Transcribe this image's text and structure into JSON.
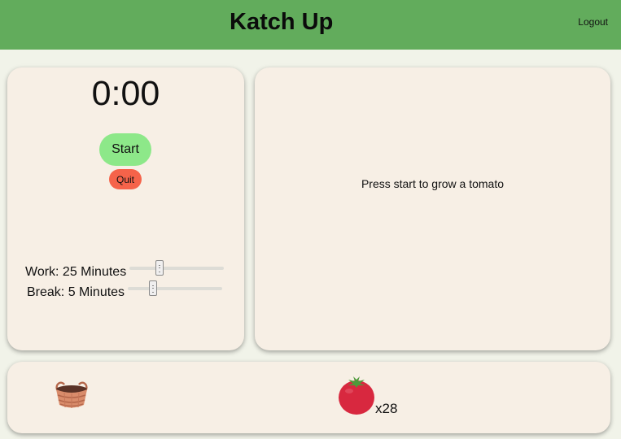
{
  "header": {
    "title": "Katch Up",
    "logout_label": "Logout",
    "background_color": "#62ac5c"
  },
  "timer": {
    "display": "0:00",
    "start_label": "Start",
    "quit_label": "Quit",
    "work_label": "Work: 25 Minutes",
    "break_label": "Break: 5 Minutes",
    "work_minutes": 25,
    "break_minutes": 5
  },
  "display": {
    "message": "Press start to grow a tomato"
  },
  "basket": {
    "basket_icon": "basket-icon",
    "tomato_icon": "tomato-icon",
    "tomato_count": "x28"
  },
  "colors": {
    "start_button": "#8de889",
    "quit_button": "#f5634a",
    "card_background": "#f7efe5",
    "tomato": "#d8283f"
  }
}
